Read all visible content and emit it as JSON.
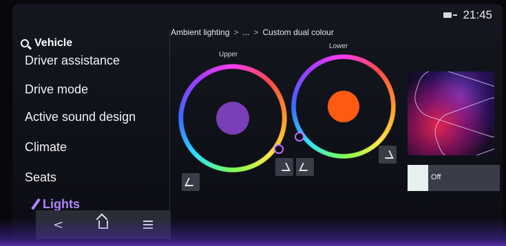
{
  "status": {
    "time": "21:45",
    "icon": "battery-plug-icon"
  },
  "menu": {
    "title": "Vehicle",
    "items": [
      {
        "label": "Driver assistance"
      },
      {
        "label": "Drive mode"
      },
      {
        "label": "Active sound design"
      },
      {
        "label": "Climate"
      },
      {
        "label": "Seats"
      },
      {
        "label": "Lights",
        "active": true
      }
    ]
  },
  "nav": {
    "back": "<",
    "home_icon": "home-icon",
    "menu_icon": "menu-icon"
  },
  "breadcrumb": {
    "root": "Ambient lighting",
    "sep": ">",
    "mid": "...",
    "current": "Custom dual colour"
  },
  "zones": {
    "upper": {
      "label": "Upper",
      "color": "#7a3fb8"
    },
    "lower": {
      "label": "Lower",
      "color": "#ff5a12"
    }
  },
  "toggle": {
    "label": "Off"
  },
  "colors": {
    "accent": "#b184ff",
    "panel": "#3a3d48"
  }
}
